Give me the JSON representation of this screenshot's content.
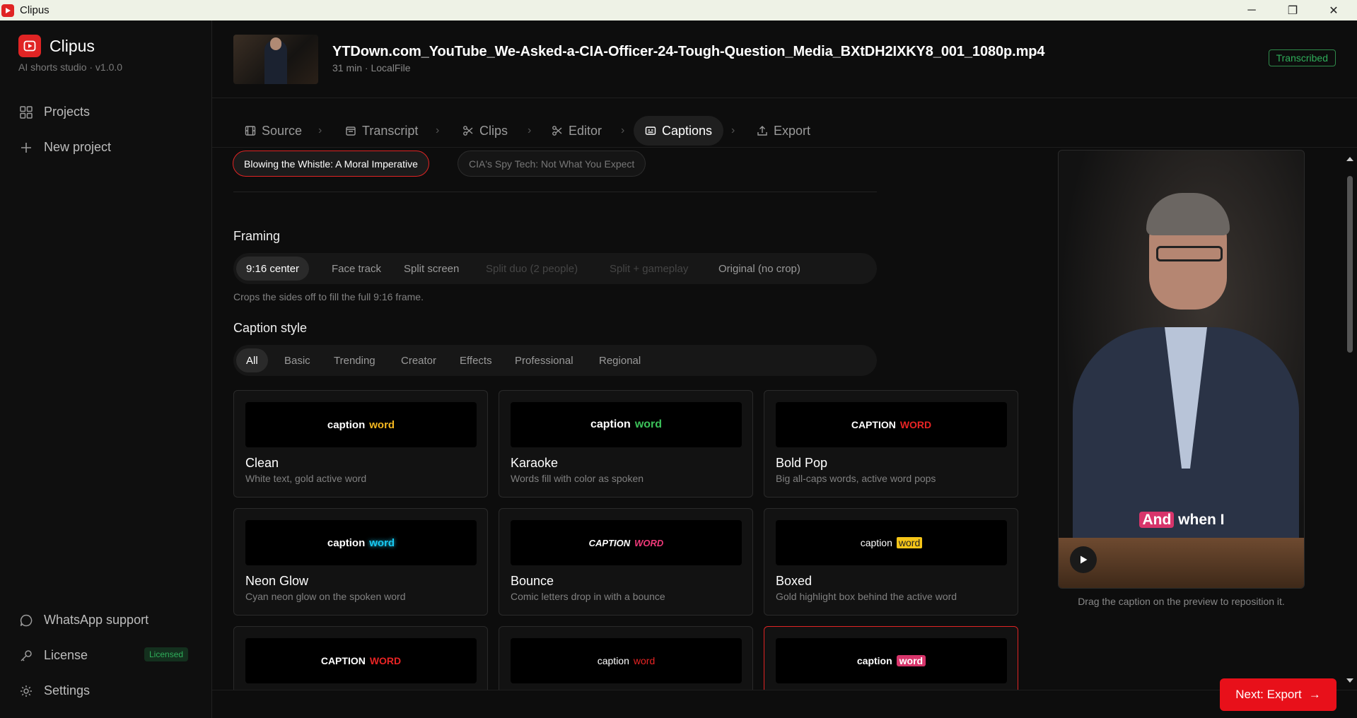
{
  "window": {
    "title": "Clipus",
    "minimize": "─",
    "maximize": "❐",
    "close": "✕"
  },
  "sidebar": {
    "brand": "Clipus",
    "subtitle": "AI shorts studio · v1.0.0",
    "nav": [
      {
        "label": "Projects"
      },
      {
        "label": "New project"
      }
    ],
    "bottom": [
      {
        "label": "WhatsApp support"
      },
      {
        "label": "License",
        "badge": "Licensed"
      },
      {
        "label": "Settings"
      }
    ]
  },
  "header": {
    "filename": "YTDown.com_YouTube_We-Asked-a-CIA-Officer-24-Tough-Question_Media_BXtDH2IXKY8_001_1080p.mp4",
    "meta": "31 min · LocalFile",
    "status": "Transcribed"
  },
  "tabs": [
    {
      "label": "Source",
      "icon": "film-icon"
    },
    {
      "label": "Transcript",
      "icon": "document-icon"
    },
    {
      "label": "Clips",
      "icon": "scissors-icon"
    },
    {
      "label": "Editor",
      "icon": "scissors-icon"
    },
    {
      "label": "Captions",
      "icon": "captions-icon",
      "active": true
    },
    {
      "label": "Export",
      "icon": "upload-icon"
    }
  ],
  "clips": [
    {
      "label": "Blowing the Whistle: A Moral Imperative",
      "selected": true
    },
    {
      "label": "CIA's Spy Tech: Not What You Expect",
      "selected": false
    }
  ],
  "framing": {
    "title": "Framing",
    "options": [
      "9:16 center",
      "Face track",
      "Split screen",
      "Split duo (2 people)",
      "Split + gameplay",
      "Original (no crop)"
    ],
    "selected": "9:16 center",
    "hint": "Crops the sides off to fill the full 9:16 frame."
  },
  "caption_style": {
    "title": "Caption style",
    "filters": [
      "All",
      "Basic",
      "Trending",
      "Creator",
      "Effects",
      "Professional",
      "Regional"
    ],
    "selected_filter": "All",
    "styles": [
      {
        "name": "Clean",
        "desc": "White text, gold active word",
        "preview_a": "caption",
        "preview_b": "word",
        "accent": "#f5b820"
      },
      {
        "name": "Karaoke",
        "desc": "Words fill with color as spoken",
        "preview_a": "caption",
        "preview_b": "word",
        "accent": "#3cc25a"
      },
      {
        "name": "Bold Pop",
        "desc": "Big all-caps words, active word pops",
        "preview_a": "CAPTION",
        "preview_b": "WORD",
        "accent": "#e82424"
      },
      {
        "name": "Neon Glow",
        "desc": "Cyan neon glow on the spoken word",
        "preview_a": "caption",
        "preview_b": "word",
        "accent": "#19c8f0"
      },
      {
        "name": "Bounce",
        "desc": "Comic letters drop in with a bounce",
        "preview_a": "CAPTION",
        "preview_b": "WORD",
        "accent": "#f03a7a"
      },
      {
        "name": "Boxed",
        "desc": "Gold highlight box behind the active word",
        "preview_a": "caption",
        "preview_b": "word",
        "accent": "#f5c518"
      },
      {
        "name": "",
        "desc": "",
        "preview_a": "CAPTION",
        "preview_b": "WORD",
        "accent": "#e82424"
      },
      {
        "name": "",
        "desc": "",
        "preview_a": "caption",
        "preview_b": "word",
        "accent": "#e82424"
      },
      {
        "name": "",
        "desc": "",
        "preview_a": "caption",
        "preview_b": "word",
        "accent": "#d8356b",
        "selected": true
      }
    ]
  },
  "preview": {
    "caption_a": "And",
    "caption_b": "when I",
    "note": "Drag the caption on the preview to reposition it."
  },
  "footer": {
    "next_label": "Next: Export",
    "next_arrow": "→"
  }
}
